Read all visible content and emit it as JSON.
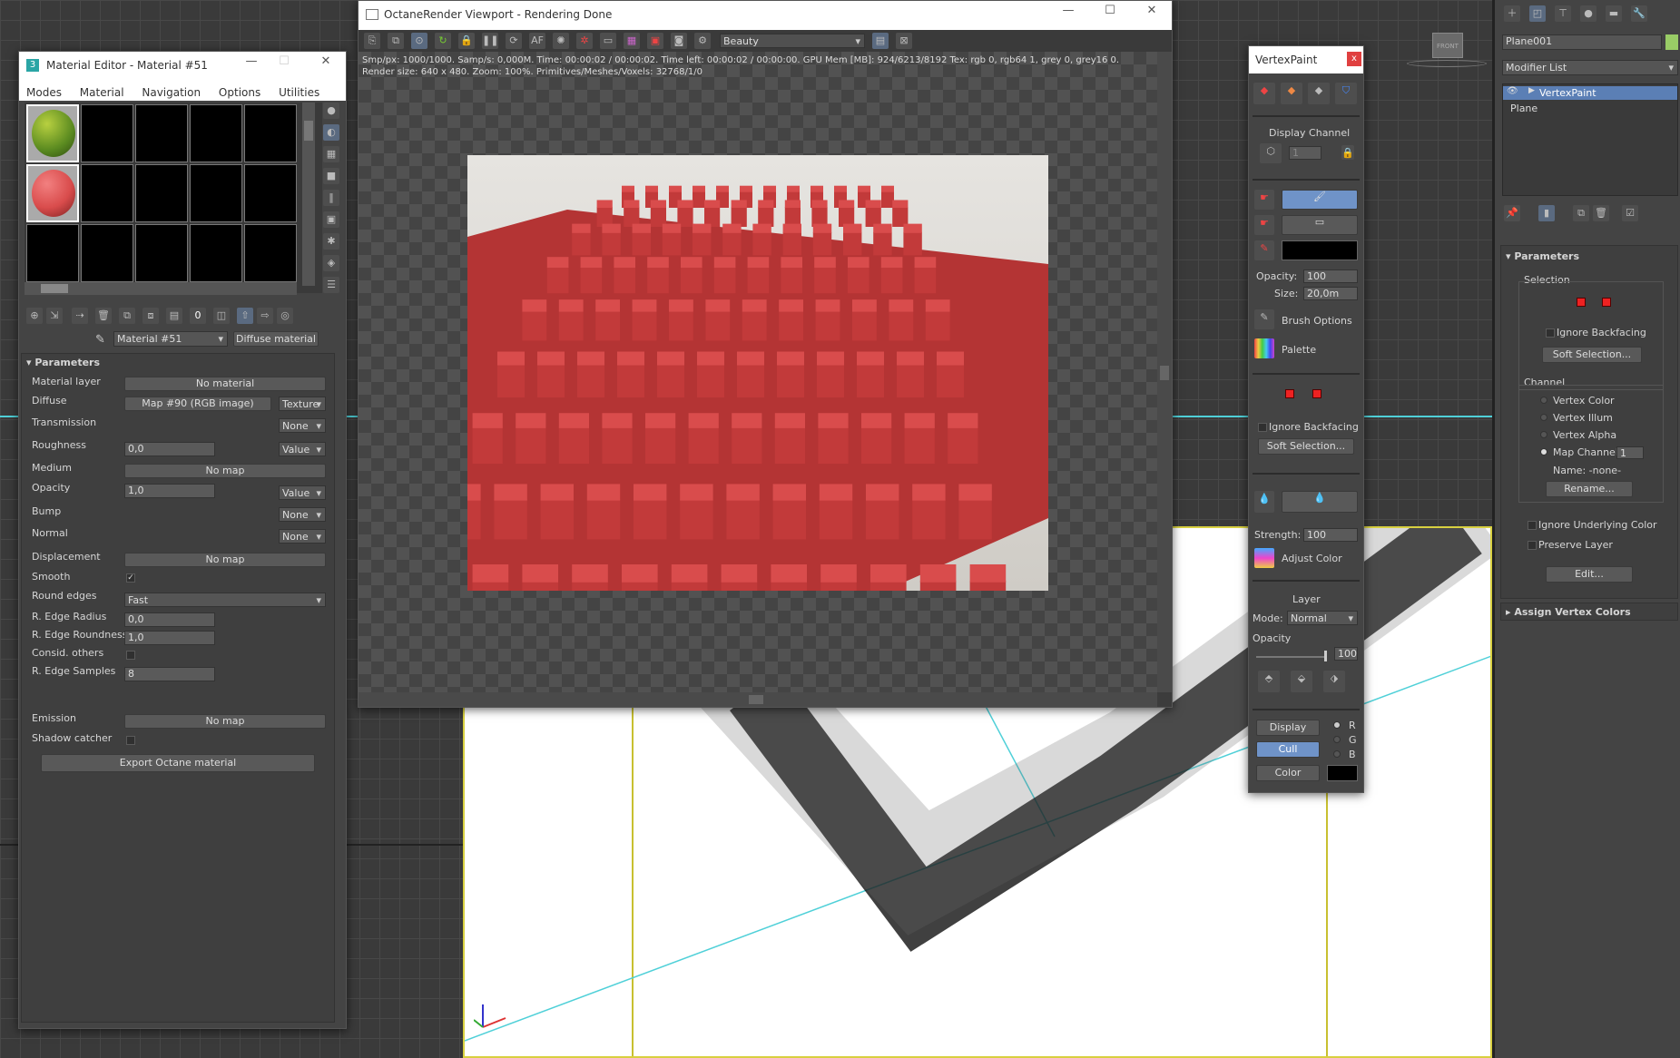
{
  "material_editor": {
    "title": "Material Editor - Material #51",
    "menu": [
      "Modes",
      "Material",
      "Navigation",
      "Options",
      "Utilities"
    ],
    "material_name": "Material #51",
    "material_type": "Diffuse material",
    "section": "Parameters",
    "rows": {
      "material_layer": {
        "label": "Material layer",
        "value": "No material"
      },
      "diffuse": {
        "label": "Diffuse",
        "value": "Map #90 (RGB image)",
        "mode": "Texture"
      },
      "transmission": {
        "label": "Transmission",
        "mode": "None"
      },
      "roughness": {
        "label": "Roughness",
        "value": "0,0",
        "mode": "Value"
      },
      "medium": {
        "label": "Medium",
        "value": "No map"
      },
      "opacity": {
        "label": "Opacity",
        "value": "1,0",
        "mode": "Value"
      },
      "bump": {
        "label": "Bump",
        "mode": "None"
      },
      "normal": {
        "label": "Normal",
        "mode": "None"
      },
      "displacement": {
        "label": "Displacement",
        "value": "No map"
      },
      "smooth": {
        "label": "Smooth",
        "checked": "✓"
      },
      "round_edges": {
        "label": "Round edges",
        "value": "Fast"
      },
      "r_edge_radius": {
        "label": "R. Edge Radius",
        "value": "0,0"
      },
      "r_edge_roundness": {
        "label": "R. Edge Roundness",
        "value": "1,0"
      },
      "consid_others": {
        "label": "Consid. others"
      },
      "r_edge_samples": {
        "label": "R. Edge Samples",
        "value": "8"
      },
      "emission": {
        "label": "Emission",
        "value": "No map"
      },
      "shadow_catcher": {
        "label": "Shadow catcher"
      }
    },
    "export_button": "Export Octane material"
  },
  "octane": {
    "title": "OctaneRender Viewport - Rendering Done",
    "pass": "Beauty",
    "status_line1": "Smp/px: 1000/1000.   Samp/s: 0,000M.   Time: 00:00:02 / 00:00:02.   Time left: 00:00:02 / 00:00:00.   GPU Mem [MB]: 924/6213/8192   Tex: rgb 0, rgb64 1, grey 0, grey16 0.",
    "status_line2": "Render size: 640 x 480.   Zoom: 100%.   Primitives/Meshes/Voxels: 32768/1/0",
    "render_color": "#d94c4c"
  },
  "vertex_paint": {
    "title": "VertexPaint",
    "display_channel_label": "Display Channel",
    "display_channel_value": "1",
    "opacity_label": "Opacity:",
    "opacity_value": "100",
    "size_label": "Size:",
    "size_value": "20,0m",
    "brush_options": "Brush Options",
    "palette": "Palette",
    "ignore_backfacing": "Ignore Backfacing",
    "soft_selection": "Soft Selection...",
    "strength_label": "Strength:",
    "strength_value": "100",
    "adjust_color": "Adjust Color",
    "layer_label": "Layer",
    "mode_label": "Mode:",
    "mode_value": "Normal",
    "layer_opacity_label": "Opacity",
    "layer_opacity_value": "100",
    "display_btn": "Display",
    "cull_btn": "Cull",
    "color_btn": "Color",
    "r": "R",
    "g": "G",
    "b": "B",
    "close": "x"
  },
  "command_panel": {
    "object_name": "Plane001",
    "modifier_list": "Modifier List",
    "stack": [
      "VertexPaint",
      "Plane"
    ],
    "parameters": "Parameters",
    "selection": "Selection",
    "ignore_backfacing": "Ignore Backfacing",
    "soft_selection": "Soft Selection...",
    "channel": "Channel",
    "vertex_color": "Vertex Color",
    "vertex_illum": "Vertex Illum",
    "vertex_alpha": "Vertex Alpha",
    "map_channel": "Map Channel",
    "map_channel_value": "1",
    "name_label": "Name: -none-",
    "rename": "Rename...",
    "ignore_underlying": "Ignore Underlying Color",
    "preserve_layer": "Preserve Layer",
    "edit": "Edit...",
    "assign_vertex_colors": "Assign Vertex Colors"
  },
  "viewcube_label": "FRONT"
}
